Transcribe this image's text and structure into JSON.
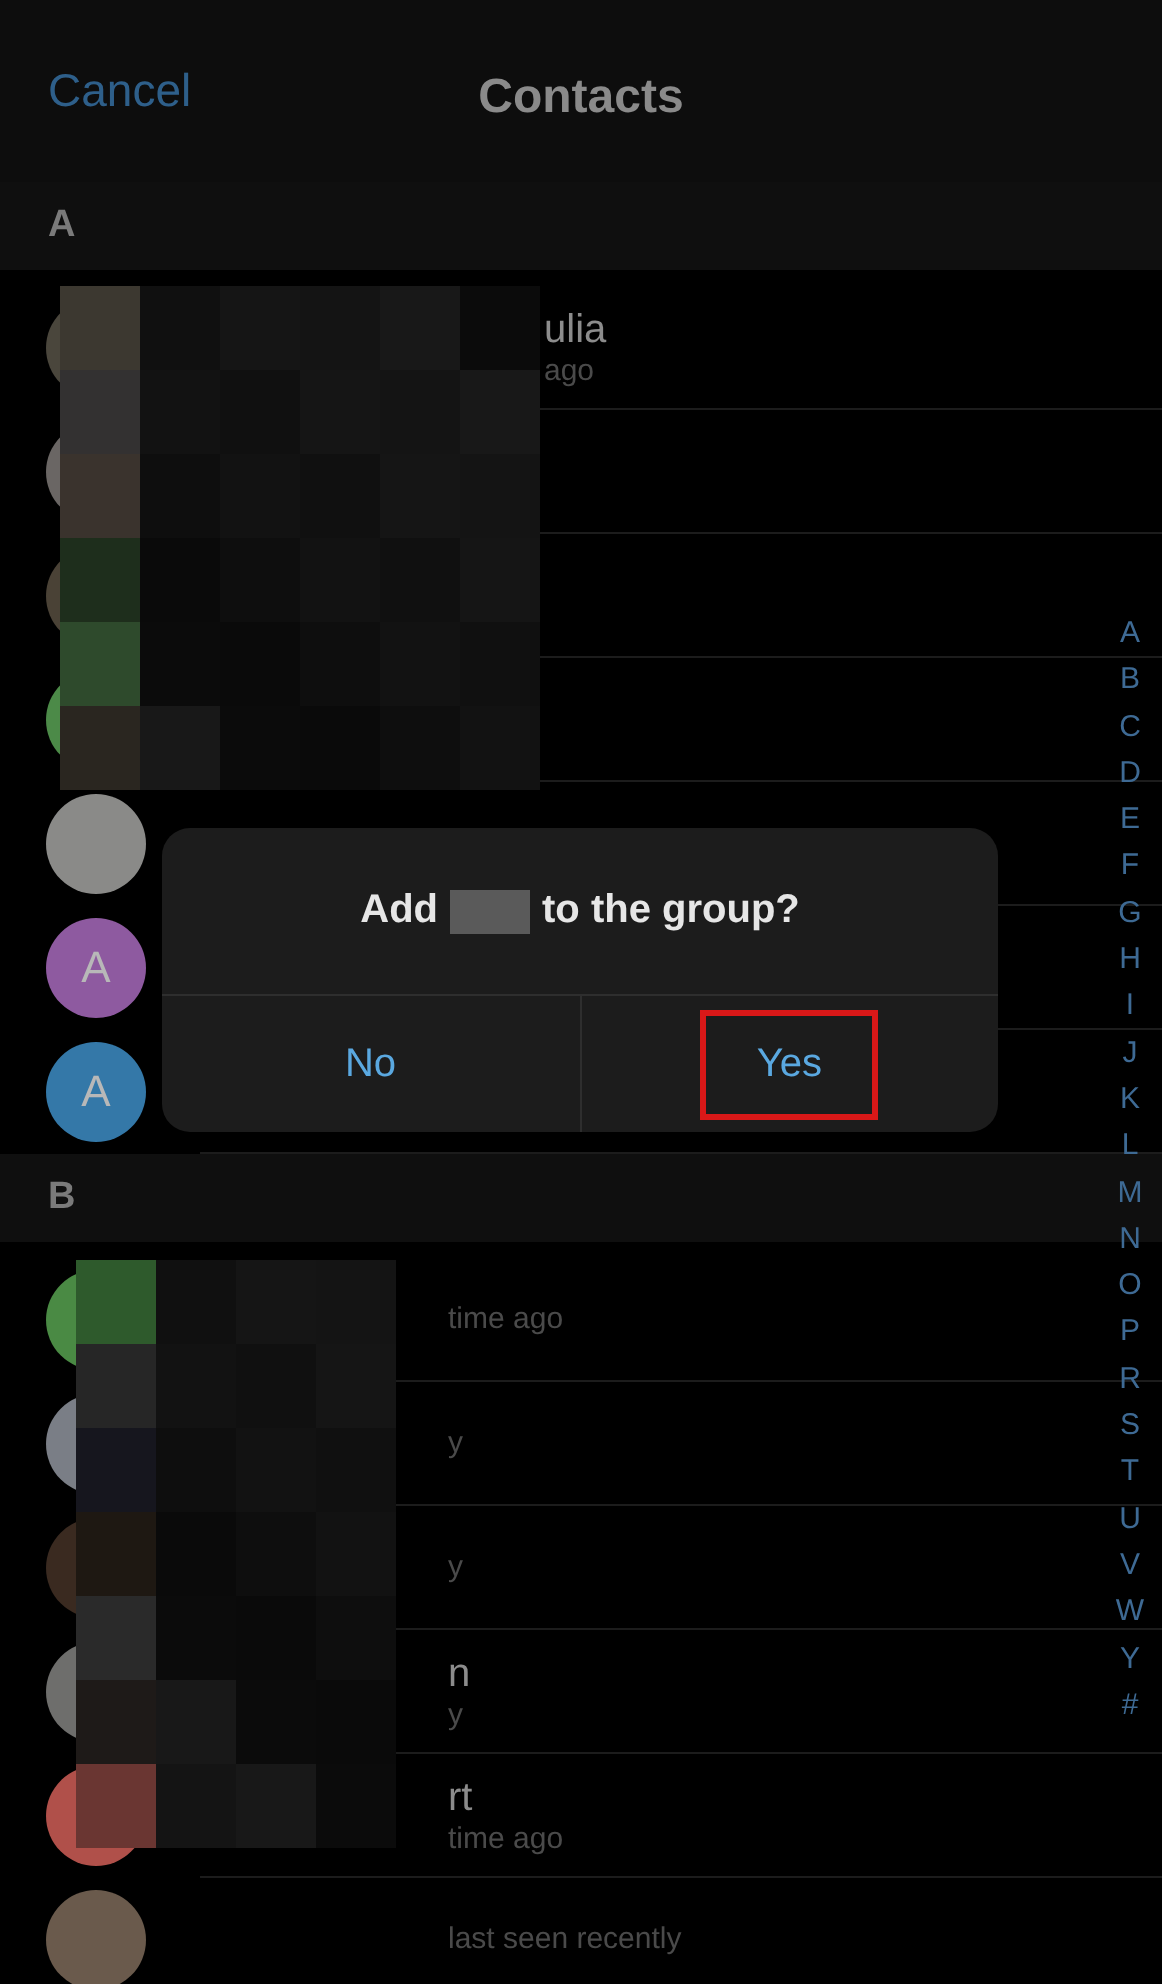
{
  "header": {
    "cancel": "Cancel",
    "title": "Contacts"
  },
  "sections": [
    {
      "letter": "A",
      "kind": "a",
      "rows": [
        {
          "color": "#4a463c",
          "name": "ulia",
          "status": "ago"
        },
        {
          "color": "#6a6664"
        },
        {
          "color": "#4a4236"
        },
        {
          "color": "#4c8a48"
        },
        {
          "color": "#8a8a88"
        },
        {
          "color": "#8e5aa0",
          "avatar_letter": "A"
        },
        {
          "color": "#3478a8",
          "avatar_letter": "A"
        }
      ]
    },
    {
      "letter": "B",
      "kind": "b",
      "rows": [
        {
          "color": "#4a8a44",
          "status": "time ago"
        },
        {
          "color": "#7a7e86",
          "status": "y"
        },
        {
          "color": "#3a2a20",
          "status": "y"
        },
        {
          "color": "#6e6e6c",
          "name": "n",
          "status": "y"
        },
        {
          "color": "#b0504a",
          "name": "rt",
          "status": "time ago"
        },
        {
          "color": "#6a5a4c",
          "status": "last seen recently"
        }
      ]
    }
  ],
  "index": [
    "A",
    "B",
    "C",
    "D",
    "E",
    "F",
    "G",
    "H",
    "I",
    "J",
    "K",
    "L",
    "M",
    "N",
    "O",
    "P",
    "R",
    "S",
    "T",
    "U",
    "V",
    "W",
    "Y",
    "#"
  ],
  "dialog": {
    "title_before": "Add",
    "title_after": "to the group?",
    "buttons": [
      {
        "label": "No",
        "highlighted": false
      },
      {
        "label": "Yes",
        "highlighted": true
      }
    ]
  }
}
